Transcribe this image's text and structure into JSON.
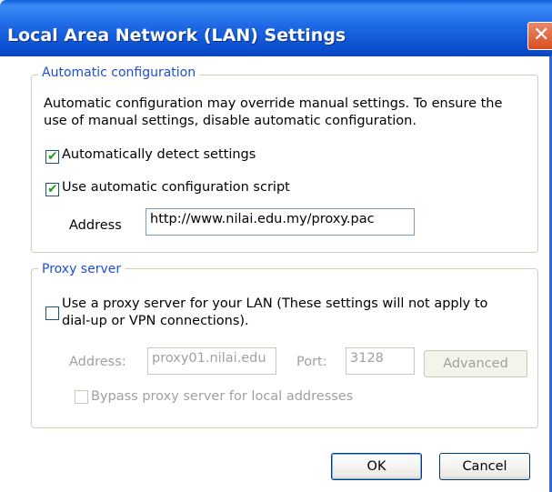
{
  "window": {
    "title": "Local Area Network (LAN) Settings",
    "close_glyph": "✕"
  },
  "auto_config": {
    "legend": "Automatic configuration",
    "description_line1": "Automatic configuration may override manual settings.  To ensure the",
    "description_line2": "use of manual settings, disable automatic configuration.",
    "detect_label": "Automatically detect settings",
    "detect_checked": true,
    "script_label": "Use automatic configuration script",
    "script_checked": true,
    "address_label": "Address",
    "address_value": "http://www.nilai.edu.my/proxy.pac"
  },
  "proxy": {
    "legend": "Proxy server",
    "use_proxy_line1": "Use a proxy server for your LAN (These settings will not apply to",
    "use_proxy_line2": "dial-up or VPN connections).",
    "use_proxy_checked": false,
    "address_label": "Address:",
    "address_value": "proxy01.nilai.edu",
    "port_label": "Port:",
    "port_value": "3128",
    "advanced_label": "Advanced",
    "bypass_label": "Bypass proxy server for local addresses",
    "bypass_checked": false
  },
  "buttons": {
    "ok": "OK",
    "cancel": "Cancel"
  },
  "icons": {
    "check": "check-icon",
    "close": "close-icon"
  },
  "colors": {
    "title_bar": "#0a5ddb",
    "legend": "#1f4fcf",
    "check": "#21a121",
    "close": "#d84e1e"
  }
}
